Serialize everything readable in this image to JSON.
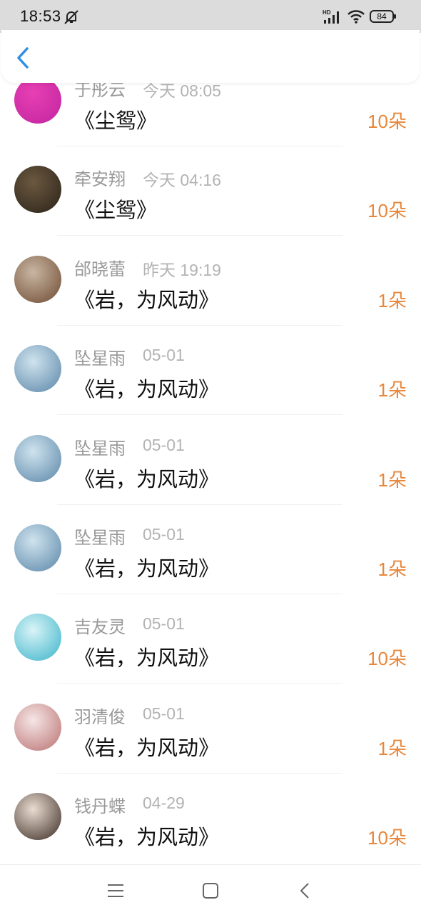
{
  "status_bar": {
    "time": "18:53",
    "network_label": "HD",
    "battery_level": "84"
  },
  "header": {
    "back_icon": "chevron-left-icon"
  },
  "rows": [
    {
      "name": "于彤云",
      "time": "今天 08:05",
      "title": "《尘鸳》",
      "amount": "10朵",
      "avatar_colors": [
        "#e83fb3",
        "#c025a0"
      ]
    },
    {
      "name": "牵安翔",
      "time": "今天 04:16",
      "title": "《尘鸳》",
      "amount": "10朵",
      "avatar_colors": [
        "#6b5840",
        "#2a2318"
      ]
    },
    {
      "name": "邰晓蕾",
      "time": "昨天 19:19",
      "title": "《岩，为风动》",
      "amount": "1朵",
      "avatar_colors": [
        "#c8b6a2",
        "#6e4a32"
      ]
    },
    {
      "name": "坠星雨",
      "time": "05-01",
      "title": "《岩，为风动》",
      "amount": "1朵",
      "avatar_colors": [
        "#cfe3ee",
        "#5a86a8"
      ]
    },
    {
      "name": "坠星雨",
      "time": "05-01",
      "title": "《岩，为风动》",
      "amount": "1朵",
      "avatar_colors": [
        "#cfe3ee",
        "#5a86a8"
      ]
    },
    {
      "name": "坠星雨",
      "time": "05-01",
      "title": "《岩，为风动》",
      "amount": "1朵",
      "avatar_colors": [
        "#cfe3ee",
        "#5a86a8"
      ]
    },
    {
      "name": "吉友灵",
      "time": "05-01",
      "title": "《岩，为风动》",
      "amount": "10朵",
      "avatar_colors": [
        "#d9f4f7",
        "#3ab3c9"
      ]
    },
    {
      "name": "羽清俊",
      "time": "05-01",
      "title": "《岩，为风动》",
      "amount": "1朵",
      "avatar_colors": [
        "#f6e6e6",
        "#b97070"
      ]
    },
    {
      "name": "钱丹蝶",
      "time": "04-29",
      "title": "《岩，为风动》",
      "amount": "10朵",
      "avatar_colors": [
        "#e9dcd0",
        "#3a2a22"
      ]
    }
  ],
  "bottom_nav": {
    "menu_icon": "menu-icon",
    "home_icon": "home-square-icon",
    "back_icon": "back-triangle-icon"
  },
  "colors": {
    "accent": "#e8873a",
    "back_arrow": "#2f8fe0"
  }
}
